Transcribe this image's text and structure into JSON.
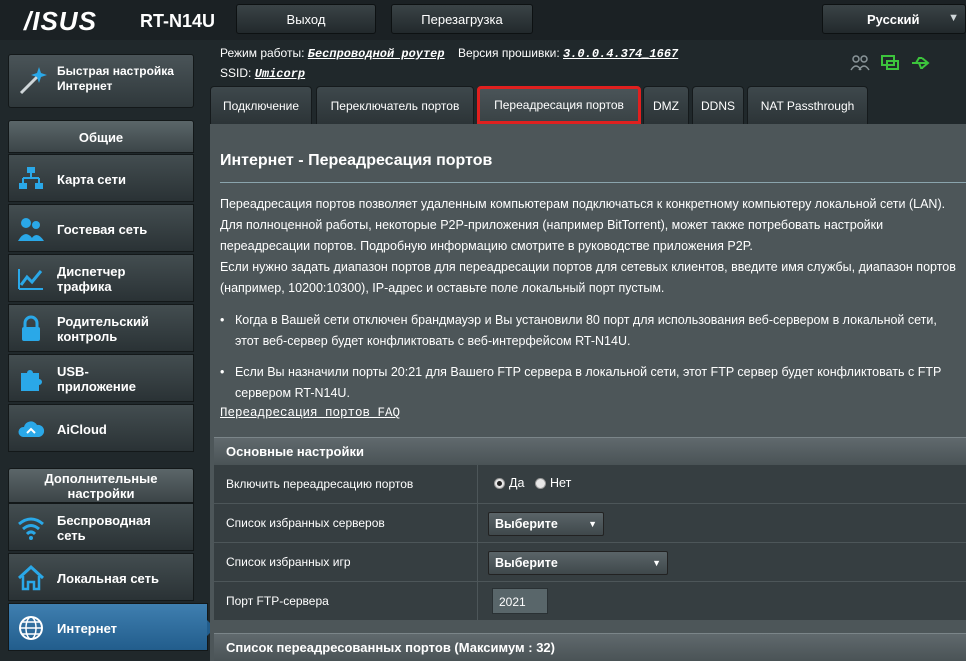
{
  "header": {
    "brand": "/ISUS",
    "model": "RT-N14U",
    "logout_label": "Выход",
    "reboot_label": "Перезагрузка",
    "language": "Русский"
  },
  "info": {
    "mode_label": "Режим работы:",
    "mode_value": "Беспроводной роутер",
    "firmware_label": "Версия прошивки:",
    "firmware_value": "3.0.0.4.374_1667",
    "ssid_label": "SSID:",
    "ssid_value": "Umicorp"
  },
  "sidebar": {
    "quick_setup_line1": "Быстрая настройка",
    "quick_setup_line2": "Интернет",
    "general_header": "Общие",
    "items": [
      {
        "line1": "Карта сети",
        "line2": ""
      },
      {
        "line1": "Гостевая сеть",
        "line2": ""
      },
      {
        "line1": "Диспетчер",
        "line2": "трафика"
      },
      {
        "line1": "Родительский",
        "line2": "контроль"
      },
      {
        "line1": "USB-",
        "line2": "приложение"
      },
      {
        "line1": "AiCloud",
        "line2": ""
      }
    ],
    "advanced_header_line1": "Дополнительные",
    "advanced_header_line2": "настройки",
    "advanced_items": [
      {
        "line1": "Беспроводная",
        "line2": "сеть"
      },
      {
        "line1": "Локальная сеть",
        "line2": ""
      },
      {
        "line1": "Интернет",
        "line2": ""
      }
    ]
  },
  "tabs": [
    {
      "label": "Подключение"
    },
    {
      "label": "Переключатель портов"
    },
    {
      "label": "Переадресация портов"
    },
    {
      "label": "DMZ"
    },
    {
      "label": "DDNS"
    },
    {
      "label": "NAT Passthrough"
    }
  ],
  "page": {
    "title": "Интернет - Переадресация портов",
    "desc1": "Переадресация портов позволяет удаленным компьютерам подключаться к конкретному компьютеру локальной сети (LAN). Для полноценной работы, некоторые P2P-приложения (например BitTorrent), может также потребовать настройки переадресации портов. Подробную информацию смотрите в руководстве приложения P2P.",
    "desc2": "Если нужно задать диапазон портов для переадресации портов для сетевых клиентов, введите имя службы, диапазон портов (например, 10200:10300), IP-адрес и оставьте поле локальный порт пустым.",
    "bullet1": "Когда в Вашей сети отключен брандмауэр и Вы установили 80 порт для использования веб-сервером в локальной сети, этот веб-сервер будет конфликтовать с веб-интерфейсом RT-N14U.",
    "bullet2": "Если Вы назначили порты 20:21 для Вашего FTP сервера в локальной сети, этот FTP сервер будет конфликтовать с FTP сервером RT-N14U.",
    "faq": "Переадресация портов FAQ"
  },
  "basic": {
    "header": "Основные настройки",
    "enable_label": "Включить переадресацию портов",
    "yes_label": "Да",
    "no_label": "Нет",
    "servers_label": "Список избранных серверов",
    "servers_value": "Выберите",
    "games_label": "Список избранных игр",
    "games_value": "Выберите",
    "ftp_label": "Порт FTP-сервера",
    "ftp_value": "2021"
  },
  "forwarded": {
    "header": "Список переадресованных портов (Максимум : 32)"
  },
  "colors": {
    "accent_red": "#e0201f",
    "active_blue": "#2f6fa3",
    "icon_blue": "#2aa8e8",
    "status_green": "#3cc43c"
  }
}
